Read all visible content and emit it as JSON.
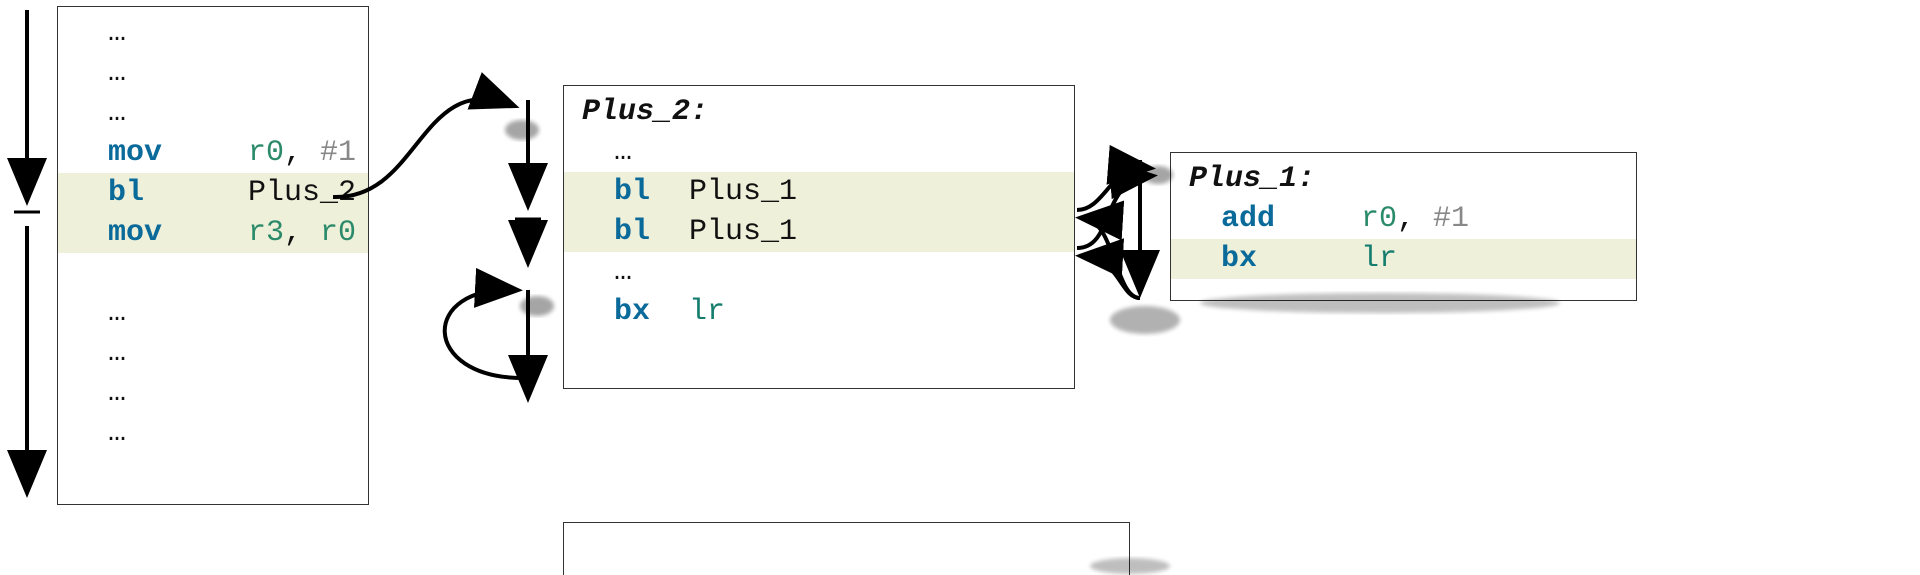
{
  "main": {
    "lines": [
      {
        "ell": "…"
      },
      {
        "ell": "…"
      },
      {
        "ell": "…"
      },
      {
        "op": "mov",
        "a1": "r0",
        "sep": ", ",
        "a2": "#1",
        "a2c": "imm"
      },
      {
        "op": "bl",
        "a1": "Plus_2",
        "a1c": "txt",
        "hl": true
      },
      {
        "op": "mov",
        "a1": "r3",
        "sep": ", ",
        "a2": "r0",
        "a2c": "reg",
        "hl": true
      },
      {
        "ell": ""
      },
      {
        "ell": "…"
      },
      {
        "ell": "…"
      },
      {
        "ell": "…"
      },
      {
        "ell": "…"
      }
    ]
  },
  "plus2": {
    "label": "Plus_2:",
    "lines": [
      {
        "ell": "…"
      },
      {
        "op": "bl",
        "a1": "Plus_1",
        "a1c": "txt",
        "hl": true
      },
      {
        "op": "bl",
        "a1": "Plus_1",
        "a1c": "txt",
        "hl": true
      },
      {
        "ell": "…"
      },
      {
        "op": "bx",
        "a1": "lr",
        "a1c": "irg"
      }
    ]
  },
  "plus1": {
    "label": "Plus_1:",
    "lines": [
      {
        "op": "add",
        "a1": "r0",
        "sep": ", ",
        "a2": "#1",
        "a2c": "imm"
      },
      {
        "op": "bx",
        "a1": "lr",
        "a1c": "irg",
        "hl": true
      }
    ]
  }
}
